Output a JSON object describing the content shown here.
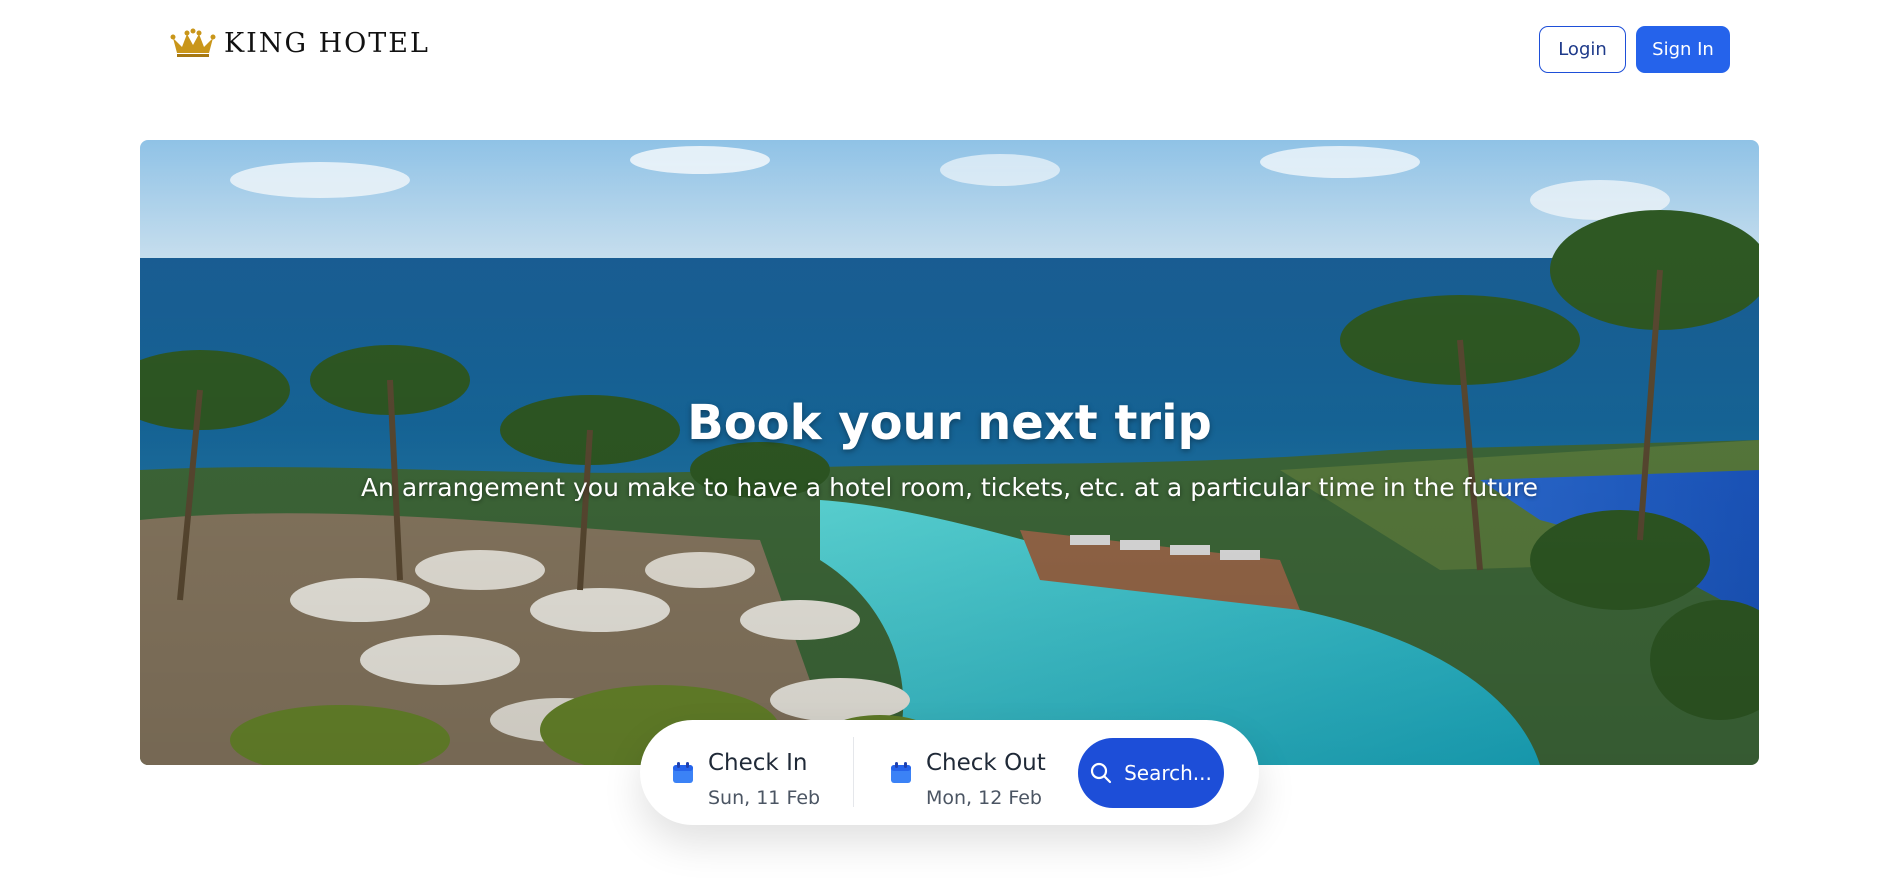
{
  "header": {
    "brand": "KING HOTEL",
    "logo_icon": "crown-icon",
    "login_label": "Login",
    "signin_label": "Sign In"
  },
  "hero": {
    "title": "Book your next trip",
    "subtitle": "An arrangement you make to have a hotel room, tickets, etc. at a particular time in the future"
  },
  "search": {
    "check_in_label": "Check In",
    "check_in_value": "Sun, 11 Feb",
    "check_out_label": "Check Out",
    "check_out_value": "Mon, 12 Feb",
    "button_label": "Search...",
    "calendar_icon": "calendar-icon",
    "search_icon": "search-icon"
  },
  "colors": {
    "primary": "#2563eb",
    "primary_dark": "#1d4ed8",
    "logo_gold": "#c9961a",
    "text_dark": "#1f2937"
  }
}
